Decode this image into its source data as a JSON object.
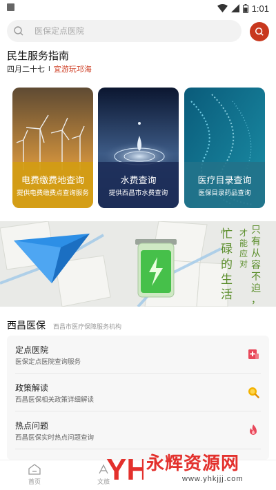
{
  "status": {
    "time": "1:01"
  },
  "search": {
    "placeholder": "医保定点医院"
  },
  "guide": {
    "title": "民生服务指南",
    "date": "四月二十七",
    "separator": "I",
    "link": "宜游玩邛海"
  },
  "cards": [
    {
      "title": "电费缴费地查询",
      "desc": "提供电费缴费点查询服务",
      "band_color": "#d39c12"
    },
    {
      "title": "水费查询",
      "desc": "提供西昌市水费查询",
      "band_color": "#1d2e59"
    },
    {
      "title": "医疗目录查询",
      "desc": "医保目录药品查询",
      "band_color": "#22728a"
    }
  ],
  "banner": {
    "col1": [
      "忙",
      "碌",
      "的",
      "生",
      "活"
    ],
    "col2": [
      "才",
      "能",
      "应",
      "对"
    ],
    "col3": [
      "只",
      "有",
      "从",
      "容",
      "不",
      "迫",
      "，"
    ]
  },
  "section": {
    "title": "西昌医保",
    "subtitle": "西昌市医疗保障服务机构"
  },
  "list": [
    {
      "title": "定点医院",
      "subtitle": "医保定点医院查询服务",
      "icon": "hospital-icon"
    },
    {
      "title": "政策解读",
      "subtitle": "西昌医保相关政策详细解读",
      "icon": "search-icon"
    },
    {
      "title": "热点问题",
      "subtitle": "西昌医保实时热点问题查询",
      "icon": "fire-icon"
    }
  ],
  "tabs": [
    {
      "label": "首页",
      "icon": "home-icon"
    },
    {
      "label": "文旅",
      "icon": "culture-icon"
    }
  ],
  "watermark": {
    "text": "永辉资源网",
    "url": "www.yhkjjj.com",
    "logo": "YH"
  },
  "colors": {
    "accent": "#c8381e",
    "link": "#d0432a",
    "banner_text": "#5a8d2a"
  }
}
